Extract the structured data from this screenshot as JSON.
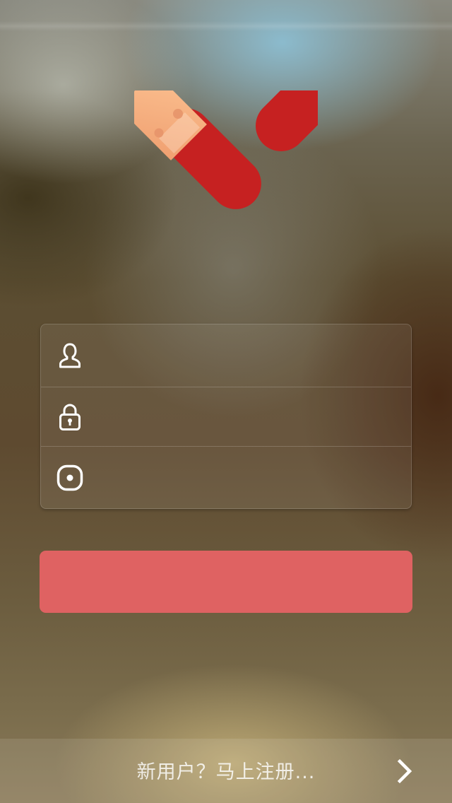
{
  "app": {
    "logo_icon": "heart-check-bandage-logo",
    "colors": {
      "brand_red": "#c62121",
      "login_button": "#df6262",
      "bandage": "#f9b98a"
    }
  },
  "login_form": {
    "username": {
      "icon": "user-icon",
      "value": "",
      "placeholder": ""
    },
    "password": {
      "icon": "lock-icon",
      "value": "",
      "placeholder": ""
    },
    "code": {
      "icon": "record-icon",
      "value": "",
      "placeholder": ""
    }
  },
  "login_button": {
    "label": ""
  },
  "register": {
    "text": "新用户？马上注册...",
    "icon": "chevron-right-icon"
  }
}
